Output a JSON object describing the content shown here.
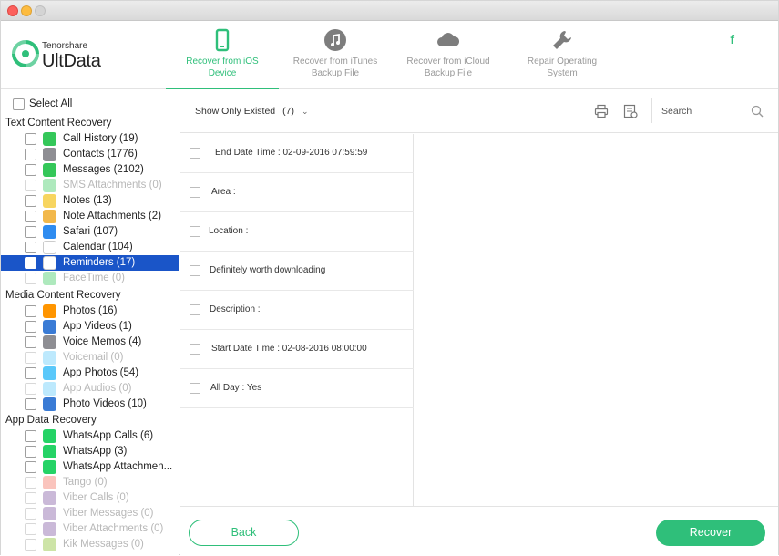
{
  "brand": {
    "small": "Tenorshare",
    "big": "UltData"
  },
  "nav": [
    {
      "line1": "Recover from iOS",
      "line2": "Device",
      "icon": "phone-icon",
      "active": true
    },
    {
      "line1": "Recover from iTunes",
      "line2": "Backup File",
      "icon": "music-icon",
      "active": false
    },
    {
      "line1": "Recover from iCloud",
      "line2": "Backup File",
      "icon": "cloud-icon",
      "active": false
    },
    {
      "line1": "Repair Operating",
      "line2": "System",
      "icon": "wrench-icon",
      "active": false
    }
  ],
  "facebook": "f",
  "sidebar": {
    "select_all": "Select All",
    "sections": {
      "text": "Text Content Recovery",
      "media": "Media Content Recovery",
      "app": "App Data Recovery"
    },
    "items": [
      {
        "label": "Call History (19)",
        "icon": "phone-icon",
        "color": "#34c759",
        "dim": false
      },
      {
        "label": "Contacts (1776)",
        "icon": "contacts-icon",
        "color": "#8e8e93",
        "dim": false
      },
      {
        "label": "Messages (2102)",
        "icon": "messages-icon",
        "color": "#34c759",
        "dim": false
      },
      {
        "label": "SMS Attachments (0)",
        "icon": "sms-attachment-icon",
        "color": "#34c759",
        "dim": true
      },
      {
        "label": "Notes (13)",
        "icon": "notes-icon",
        "color": "#f7d560",
        "dim": false
      },
      {
        "label": "Note Attachments (2)",
        "icon": "note-attachment-icon",
        "color": "#f2b84b",
        "dim": false
      },
      {
        "label": "Safari (107)",
        "icon": "safari-icon",
        "color": "#2f8cf0",
        "dim": false
      },
      {
        "label": "Calendar (104)",
        "icon": "calendar-icon",
        "color": "#ffffff",
        "dim": false
      },
      {
        "label": "Reminders (17)",
        "icon": "reminders-icon",
        "color": "#ffffff",
        "dim": false,
        "selected": true
      },
      {
        "label": "FaceTime (0)",
        "icon": "facetime-icon",
        "color": "#34c759",
        "dim": true
      },
      {
        "label": "Photos (16)",
        "icon": "photos-icon",
        "color": "#ff9500",
        "dim": false
      },
      {
        "label": "App Videos (1)",
        "icon": "app-videos-icon",
        "color": "#3a7bd5",
        "dim": false
      },
      {
        "label": "Voice Memos (4)",
        "icon": "voice-memos-icon",
        "color": "#8e8e93",
        "dim": false
      },
      {
        "label": "Voicemail (0)",
        "icon": "voicemail-icon",
        "color": "#5ac8fa",
        "dim": true
      },
      {
        "label": "App Photos (54)",
        "icon": "app-photos-icon",
        "color": "#5ac8fa",
        "dim": false
      },
      {
        "label": "App Audios (0)",
        "icon": "app-audios-icon",
        "color": "#5ac8fa",
        "dim": true
      },
      {
        "label": "Photo Videos (10)",
        "icon": "photo-videos-icon",
        "color": "#3a7bd5",
        "dim": false
      },
      {
        "label": "WhatsApp Calls (6)",
        "icon": "whatsapp-calls-icon",
        "color": "#25d366",
        "dim": false
      },
      {
        "label": "WhatsApp (3)",
        "icon": "whatsapp-icon",
        "color": "#25d366",
        "dim": false
      },
      {
        "label": "WhatsApp Attachmen...",
        "icon": "whatsapp-attachment-icon",
        "color": "#25d366",
        "dim": false
      },
      {
        "label": "Tango (0)",
        "icon": "tango-icon",
        "color": "#f26b5b",
        "dim": true
      },
      {
        "label": "Viber Calls (0)",
        "icon": "viber-calls-icon",
        "color": "#7b519d",
        "dim": true
      },
      {
        "label": "Viber Messages (0)",
        "icon": "viber-messages-icon",
        "color": "#7b519d",
        "dim": true
      },
      {
        "label": "Viber Attachments (0)",
        "icon": "viber-attachment-icon",
        "color": "#7b519d",
        "dim": true
      },
      {
        "label": "Kik Messages (0)",
        "icon": "kik-icon",
        "color": "#82bc23",
        "dim": true
      }
    ]
  },
  "toolbar": {
    "filter_label": "Show Only Existed",
    "filter_count": "(7)",
    "search_placeholder": "Search"
  },
  "detail_rows": [
    "End Date Time : 02-09-2016 07:59:59",
    "Area :",
    "Location :",
    "Definitely worth downloading",
    "Description :",
    "Start Date Time : 02-08-2016 08:00:00",
    "All Day : Yes"
  ],
  "footer": {
    "back": "Back",
    "recover": "Recover"
  },
  "colors": {
    "accent": "#2fbf7a",
    "selection": "#1a55c8"
  }
}
